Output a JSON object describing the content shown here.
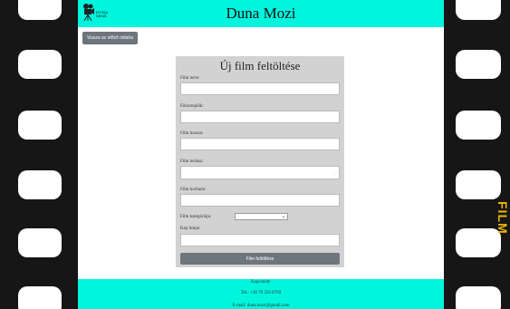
{
  "header": {
    "title": "Duna Mozi",
    "logo_text": "DUNA MOZI"
  },
  "nav": {
    "back_label": "Vissza az előző oldalra"
  },
  "form": {
    "title": "Új film feltöltése",
    "labels": {
      "name": "Film neve:",
      "director": "Főszereplők:",
      "duration": "Film hossza:",
      "description": "Film leírása:",
      "trailer": "Film korhatár:",
      "category": "Film kategóriája:",
      "image": "Kép linkje:"
    },
    "submit_label": "Film feltöltése"
  },
  "footer": {
    "heading": "Kapcsolat:",
    "phone": "Tel.: +36 70 256 8769",
    "email": "E-mail: duna.mozi@gmail.com"
  },
  "strip": {
    "side_text": "FILM"
  },
  "colors": {
    "accent": "#00f5dd",
    "button": "#6d757d",
    "form_bg": "#d2d2d2"
  }
}
